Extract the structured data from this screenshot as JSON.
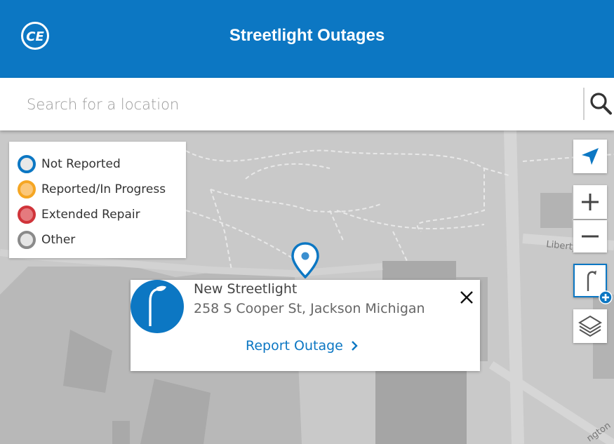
{
  "header": {
    "title": "Streetlight Outages",
    "logo_text": "CE",
    "brand_color": "#0c77c3"
  },
  "search": {
    "placeholder": "Search for a location",
    "value": "",
    "icon": "search-icon"
  },
  "legend": {
    "items": [
      {
        "label": "Not Reported",
        "color": "#0c77c3"
      },
      {
        "label": "Reported/In Progress",
        "color": "#f5a623"
      },
      {
        "label": "Extended Repair",
        "color": "#d0343a"
      },
      {
        "label": "Other",
        "color": "#8a8a8a"
      }
    ]
  },
  "map": {
    "street_label": "Liberty St",
    "street_label_2": "ngton"
  },
  "controls": {
    "locate_icon": "navigation-arrow-icon",
    "zoom_in_icon": "plus-icon",
    "zoom_out_icon": "minus-icon",
    "add_streetlight_icon": "streetlight-add-icon",
    "layers_icon": "layers-icon"
  },
  "popup": {
    "title": "New Streetlight",
    "address": "258 S Cooper St, Jackson Michigan",
    "action_label": "Report Outage",
    "close_icon": "close-icon",
    "avatar_icon": "streetlight-icon"
  }
}
